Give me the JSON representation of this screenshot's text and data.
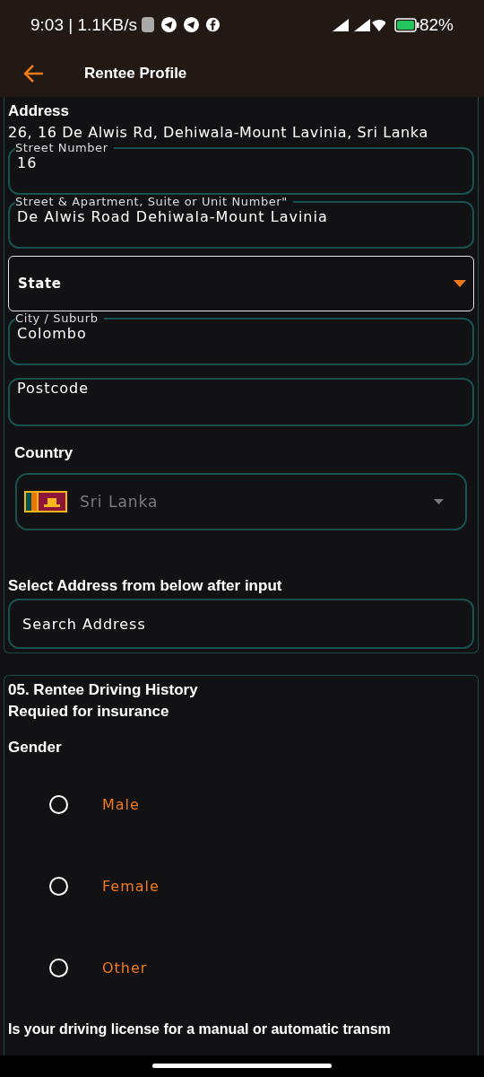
{
  "status_bar": {
    "time": "9:03 | 1.1KB/s",
    "battery": "82%"
  },
  "header": {
    "title": "Rentee Profile"
  },
  "address": {
    "heading": "Address",
    "value": "26, 16 De Alwis Rd, Dehiwala-Mount Lavinia, Sri Lanka",
    "fields": [
      {
        "kind": "outlined",
        "label": "Street Number",
        "value": "16"
      },
      {
        "kind": "outlined",
        "label": "Street & Apartment, Suite or Unit Number\"",
        "value": "De Alwis Road Dehiwala-Mount Lavinia"
      },
      {
        "kind": "select",
        "placeholder": "State"
      },
      {
        "kind": "outlined",
        "label": "City / Suburb",
        "value": "Colombo"
      },
      {
        "kind": "outlined",
        "placeholder": "Postcode"
      }
    ],
    "country": {
      "label": "Country",
      "value": "Sri Lanka",
      "disabled": true
    },
    "search": {
      "label": "Select Address from below after input",
      "placeholder": "Search Address"
    }
  },
  "driving_history": {
    "heading": "05. Rentee Driving History",
    "subheading": "Requied for insurance",
    "gender_label": "Gender",
    "options": [
      {
        "label": "Male",
        "selected": false
      },
      {
        "label": "Female",
        "selected": false
      },
      {
        "label": "Other",
        "selected": false
      }
    ],
    "question": "Is your driving license for a manual or automatic transm"
  }
}
